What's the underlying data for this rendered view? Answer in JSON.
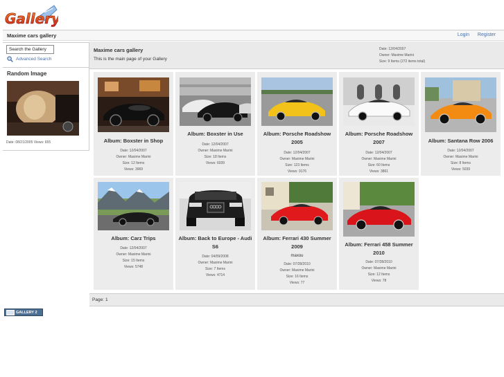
{
  "logo": {
    "text": "Gallery"
  },
  "header": {
    "gallery_title": "Maxime cars gallery",
    "login": "Login",
    "register": "Register"
  },
  "sidebar": {
    "search_value": "Search the Gallery",
    "advanced_search": "Advanced Search",
    "random_title": "Random Image",
    "random_meta": "Date: 08/21/2005 Views: 655"
  },
  "main": {
    "title": "Maxime cars gallery",
    "description": "This is the main page of your Gallery",
    "info": [
      "Date: 12/04/2007",
      "Owner: Maxime Marini",
      "Size: 9 Items (272 items total)"
    ]
  },
  "albums": [
    {
      "title": "Album: Boxster in Shop",
      "meta": [
        "Date: 12/04/2007",
        "Owner: Maxime Marini",
        "Size: 12 Items",
        "Views: 3969"
      ],
      "extra": ""
    },
    {
      "title": "Album: Boxster in Use",
      "meta": [
        "Date: 12/04/2007",
        "Owner: Maxime Marini",
        "Size: 18 Items",
        "Views: 6039"
      ],
      "extra": ""
    },
    {
      "title": "Album: Porsche Roadshow 2005",
      "meta": [
        "Date: 12/04/2007",
        "Owner: Maxime Marini",
        "Size: 123 Items",
        "Views: 9176"
      ],
      "extra": ""
    },
    {
      "title": "Album: Porsche Roadshow 2007",
      "meta": [
        "Date: 12/04/2007",
        "Owner: Maxime Marini",
        "Size: 60 Items",
        "Views: 3861"
      ],
      "extra": ""
    },
    {
      "title": "Album: Santana Row 2006",
      "meta": [
        "Date: 12/04/2007",
        "Owner: Maxime Marini",
        "Size: 8 Items",
        "Views: 5039"
      ],
      "extra": ""
    },
    {
      "title": "Album: Carz Trips",
      "meta": [
        "Date: 12/04/2007",
        "Owner: Maxime Marini",
        "Size: 15 Items",
        "Views: 5748"
      ],
      "extra": ""
    },
    {
      "title": "Album: Back to Europe - Audi S6",
      "meta": [
        "Date: 04/09/2008",
        "Owner: Maxime Marini",
        "Size: 7 Items",
        "Views: 4714"
      ],
      "extra": ""
    },
    {
      "title": "Album: Ferrari 430 Summer 2009",
      "meta": [
        "Date: 07/28/2010",
        "Owner: Maxime Marini",
        "Size: 16 Items",
        "Views: 77"
      ],
      "extra": "maxou"
    },
    {
      "title": "Album: Ferrari 458 Summer 2010",
      "meta": [
        "Date: 07/28/2010",
        "Owner: Maxime Marini",
        "Size: 12 Items",
        "Views: 78"
      ],
      "extra": ""
    }
  ],
  "pager": {
    "label": "Page:",
    "current": "1"
  },
  "footer": {
    "badge": "GALLERY 2"
  },
  "colors": {
    "link": "#4a6fa5",
    "panel": "#ececec",
    "logo_red": "#d32f1e"
  }
}
